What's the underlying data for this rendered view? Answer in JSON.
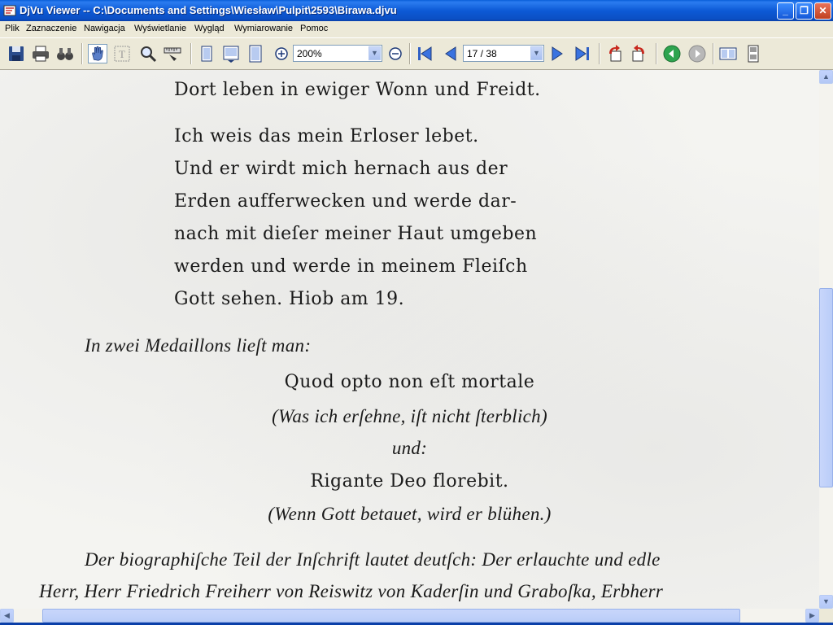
{
  "window": {
    "title": "DjVu Viewer -- C:\\Documents and Settings\\Wiesław\\Pulpit\\2593\\Birawa.djvu",
    "minimize_glyph": "_",
    "maximize_glyph": "❐",
    "close_glyph": "✕"
  },
  "menu": [
    "Plik",
    "Zaznaczenie",
    "Nawigacja",
    "Wyświetlanie",
    "Wygląd",
    "Wymiarowanie",
    "Pomoc"
  ],
  "toolbar": {
    "zoom_value": "200%",
    "page_value": "17 / 38",
    "dropdown_glyph": "▼",
    "zoom_in_glyph": "⊕",
    "zoom_out_glyph": "⊖"
  },
  "document": {
    "lines_top": [
      "Dort leben in ewiger Wonn und Freidt.",
      "Ich weis das mein Erloser lebet.",
      "Und er wirdt mich hernach aus der",
      "Erden aufferwecken und werde dar-",
      "nach mit dieſer meiner Haut umgeben",
      "werden und werde in meinem Fleiſch",
      "Gott sehen.  Hiob am 19."
    ],
    "medaillons_intro": "In zwei Medaillons lieſt man:",
    "center_lines": [
      "Quod opto non eſt mortale",
      "(Was ich erſehne, iſt nicht ſterblich)",
      "und:",
      "Rigante Deo florebit.",
      "(Wenn Gott betauet, wird er blühen.)"
    ],
    "para_line1": "Der biographiſche Teil der Inſchrift lautet deutſch: Der erlauchte und edle",
    "para_line2": "Herr, Herr Friedrich Freiherr von Reiswitz von Kaderſin und Graboſka, Erbherr"
  },
  "scrollbars": {
    "up_glyph": "▲",
    "down_glyph": "▼",
    "left_glyph": "◀",
    "right_glyph": "▶"
  },
  "colors": {
    "titlebar": "#0a5fd8",
    "chrome": "#ece9d8",
    "page": "#f4f4f1"
  }
}
